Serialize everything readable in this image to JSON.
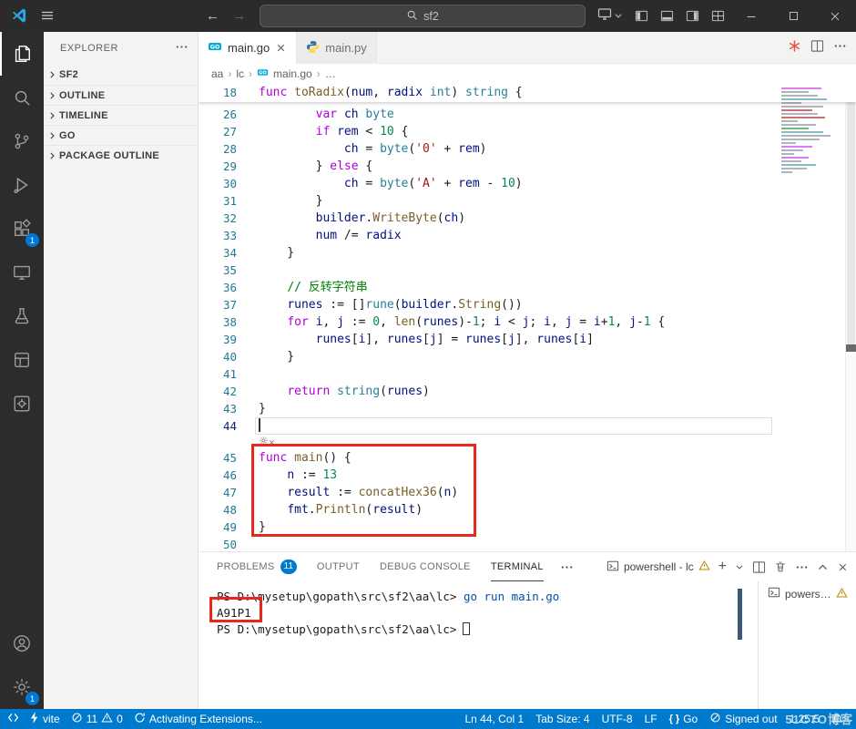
{
  "colors": {
    "accent": "#007acc",
    "badge": "#0078d4",
    "annotation_red": "#e8261c",
    "activity_bar_bg": "#2c2c2d",
    "title_bar_bg": "#2b2b2b"
  },
  "title_bar": {
    "search_value": "sf2"
  },
  "activity_bar": {
    "top": [
      {
        "icon": "explorer-icon",
        "active": true
      },
      {
        "icon": "search-icon"
      },
      {
        "icon": "source-control-icon"
      },
      {
        "icon": "run-debug-icon"
      },
      {
        "icon": "extensions-icon",
        "badge": "1"
      },
      {
        "icon": "remote-explorer-icon"
      },
      {
        "icon": "testing-icon"
      },
      {
        "icon": "app-window-icon"
      },
      {
        "icon": "gear-square-icon"
      }
    ],
    "bottom": [
      {
        "icon": "account-icon"
      },
      {
        "icon": "settings-gear-icon",
        "badge": "1"
      }
    ]
  },
  "sidebar": {
    "title": "EXPLORER",
    "sections": [
      {
        "label": "SF2"
      },
      {
        "label": "OUTLINE"
      },
      {
        "label": "TIMELINE"
      },
      {
        "label": "GO"
      },
      {
        "label": "PACKAGE OUTLINE"
      }
    ]
  },
  "editor": {
    "tabs": [
      {
        "label": "main.go",
        "icon": "go-file-icon",
        "active": true
      },
      {
        "label": "main.py",
        "icon": "python-file-icon",
        "active": false
      }
    ],
    "breadcrumb": {
      "a": "aa",
      "b": "lc",
      "file": "main.go",
      "more": "…"
    },
    "sticky": {
      "num": "18",
      "seg": [
        [
          "k",
          "func"
        ],
        [
          "p",
          " "
        ],
        [
          "f",
          "toRadix"
        ],
        [
          "p",
          "("
        ],
        [
          "v",
          "num"
        ],
        [
          "p",
          ", "
        ],
        [
          "v",
          "radix"
        ],
        [
          "p",
          " "
        ],
        [
          "t",
          "int"
        ],
        [
          "p",
          ") "
        ],
        [
          "t",
          "string"
        ],
        [
          "p",
          " {"
        ]
      ]
    },
    "lines": [
      {
        "num": "26",
        "seg": [
          [
            "p",
            "        "
          ],
          [
            "k",
            "var"
          ],
          [
            "p",
            " "
          ],
          [
            "v",
            "ch"
          ],
          [
            "p",
            " "
          ],
          [
            "t",
            "byte"
          ]
        ]
      },
      {
        "num": "27",
        "seg": [
          [
            "p",
            "        "
          ],
          [
            "k",
            "if"
          ],
          [
            "p",
            " "
          ],
          [
            "v",
            "rem"
          ],
          [
            "p",
            " < "
          ],
          [
            "n",
            "10"
          ],
          [
            "p",
            " {"
          ]
        ]
      },
      {
        "num": "28",
        "seg": [
          [
            "p",
            "            "
          ],
          [
            "v",
            "ch"
          ],
          [
            "p",
            " = "
          ],
          [
            "t",
            "byte"
          ],
          [
            "p",
            "("
          ],
          [
            "s",
            "'0'"
          ],
          [
            "p",
            " + "
          ],
          [
            "v",
            "rem"
          ],
          [
            "p",
            ")"
          ]
        ]
      },
      {
        "num": "29",
        "seg": [
          [
            "p",
            "        } "
          ],
          [
            "k",
            "else"
          ],
          [
            "p",
            " {"
          ]
        ]
      },
      {
        "num": "30",
        "seg": [
          [
            "p",
            "            "
          ],
          [
            "v",
            "ch"
          ],
          [
            "p",
            " = "
          ],
          [
            "t",
            "byte"
          ],
          [
            "p",
            "("
          ],
          [
            "s",
            "'A'"
          ],
          [
            "p",
            " + "
          ],
          [
            "v",
            "rem"
          ],
          [
            "p",
            " - "
          ],
          [
            "n",
            "10"
          ],
          [
            "p",
            ")"
          ]
        ]
      },
      {
        "num": "31",
        "seg": [
          [
            "p",
            "        }"
          ]
        ]
      },
      {
        "num": "32",
        "seg": [
          [
            "p",
            "        "
          ],
          [
            "v",
            "builder"
          ],
          [
            "p",
            "."
          ],
          [
            "f",
            "WriteByte"
          ],
          [
            "p",
            "("
          ],
          [
            "v",
            "ch"
          ],
          [
            "p",
            ")"
          ]
        ]
      },
      {
        "num": "33",
        "seg": [
          [
            "p",
            "        "
          ],
          [
            "v",
            "num"
          ],
          [
            "p",
            " /= "
          ],
          [
            "v",
            "radix"
          ]
        ]
      },
      {
        "num": "34",
        "seg": [
          [
            "p",
            "    }"
          ]
        ]
      },
      {
        "num": "35",
        "seg": []
      },
      {
        "num": "36",
        "seg": [
          [
            "p",
            "    "
          ],
          [
            "c",
            "// 反转字符串"
          ]
        ]
      },
      {
        "num": "37",
        "seg": [
          [
            "p",
            "    "
          ],
          [
            "v",
            "runes"
          ],
          [
            "p",
            " := []"
          ],
          [
            "t",
            "rune"
          ],
          [
            "p",
            "("
          ],
          [
            "v",
            "builder"
          ],
          [
            "p",
            "."
          ],
          [
            "f",
            "String"
          ],
          [
            "p",
            "())"
          ]
        ]
      },
      {
        "num": "38",
        "seg": [
          [
            "p",
            "    "
          ],
          [
            "k",
            "for"
          ],
          [
            "p",
            " "
          ],
          [
            "v",
            "i"
          ],
          [
            "p",
            ", "
          ],
          [
            "v",
            "j"
          ],
          [
            "p",
            " := "
          ],
          [
            "n",
            "0"
          ],
          [
            "p",
            ", "
          ],
          [
            "f",
            "len"
          ],
          [
            "p",
            "("
          ],
          [
            "v",
            "runes"
          ],
          [
            "p",
            ")-"
          ],
          [
            "n",
            "1"
          ],
          [
            "p",
            "; "
          ],
          [
            "v",
            "i"
          ],
          [
            "p",
            " < "
          ],
          [
            "v",
            "j"
          ],
          [
            "p",
            "; "
          ],
          [
            "v",
            "i"
          ],
          [
            "p",
            ", "
          ],
          [
            "v",
            "j"
          ],
          [
            "p",
            " = "
          ],
          [
            "v",
            "i"
          ],
          [
            "p",
            "+"
          ],
          [
            "n",
            "1"
          ],
          [
            "p",
            ", "
          ],
          [
            "v",
            "j"
          ],
          [
            "p",
            "-"
          ],
          [
            "n",
            "1"
          ],
          [
            "p",
            " {"
          ]
        ]
      },
      {
        "num": "39",
        "seg": [
          [
            "p",
            "        "
          ],
          [
            "v",
            "runes"
          ],
          [
            "p",
            "["
          ],
          [
            "v",
            "i"
          ],
          [
            "p",
            "], "
          ],
          [
            "v",
            "runes"
          ],
          [
            "p",
            "["
          ],
          [
            "v",
            "j"
          ],
          [
            "p",
            "] = "
          ],
          [
            "v",
            "runes"
          ],
          [
            "p",
            "["
          ],
          [
            "v",
            "j"
          ],
          [
            "p",
            "], "
          ],
          [
            "v",
            "runes"
          ],
          [
            "p",
            "["
          ],
          [
            "v",
            "i"
          ],
          [
            "p",
            "]"
          ]
        ]
      },
      {
        "num": "40",
        "seg": [
          [
            "p",
            "    }"
          ]
        ]
      },
      {
        "num": "41",
        "seg": []
      },
      {
        "num": "42",
        "seg": [
          [
            "p",
            "    "
          ],
          [
            "k",
            "return"
          ],
          [
            "p",
            " "
          ],
          [
            "t",
            "string"
          ],
          [
            "p",
            "("
          ],
          [
            "v",
            "runes"
          ],
          [
            "p",
            ")"
          ]
        ]
      },
      {
        "num": "43",
        "seg": [
          [
            "p",
            "}"
          ]
        ]
      },
      {
        "num": "44",
        "seg": [],
        "cursor": true,
        "current": true
      },
      {
        "num": "45",
        "seg": [
          [
            "k",
            "func"
          ],
          [
            "p",
            " "
          ],
          [
            "f",
            "main"
          ],
          [
            "p",
            "() {"
          ]
        ],
        "lens": true
      },
      {
        "num": "46",
        "seg": [
          [
            "p",
            "    "
          ],
          [
            "v",
            "n"
          ],
          [
            "p",
            " := "
          ],
          [
            "n",
            "13"
          ]
        ]
      },
      {
        "num": "47",
        "seg": [
          [
            "p",
            "    "
          ],
          [
            "v",
            "result"
          ],
          [
            "p",
            " := "
          ],
          [
            "f",
            "concatHex36"
          ],
          [
            "p",
            "("
          ],
          [
            "v",
            "n"
          ],
          [
            "p",
            ")"
          ]
        ]
      },
      {
        "num": "48",
        "seg": [
          [
            "p",
            "    "
          ],
          [
            "v",
            "fmt"
          ],
          [
            "p",
            "."
          ],
          [
            "f",
            "Println"
          ],
          [
            "p",
            "("
          ],
          [
            "v",
            "result"
          ],
          [
            "p",
            ")"
          ]
        ]
      },
      {
        "num": "49",
        "seg": [
          [
            "p",
            "}"
          ]
        ]
      },
      {
        "num": "50",
        "seg": []
      }
    ]
  },
  "panel": {
    "tabs": [
      {
        "label": "PROBLEMS",
        "badge": "11"
      },
      {
        "label": "OUTPUT"
      },
      {
        "label": "DEBUG CONSOLE"
      },
      {
        "label": "TERMINAL",
        "active": true
      }
    ],
    "terminal_chip": "powershell - lc",
    "terminal_list_item": "powers…"
  },
  "terminal": {
    "prompt": "PS D:\\mysetup\\gopath\\src\\sf2\\aa\\lc>",
    "command": "go run main.go",
    "output": "A91P1"
  },
  "status_bar": {
    "left": {
      "vite": "vite",
      "errors": "11",
      "warnings": "0",
      "activating": "Activating Extensions..."
    },
    "right": {
      "cursor": "Ln 44, Col 1",
      "tab_size": "Tab Size: 4",
      "encoding": "UTF-8",
      "eol": "LF",
      "language": "Go",
      "signed": "Signed out",
      "version": "1.25.5"
    }
  },
  "watermark": "51CTO博客"
}
